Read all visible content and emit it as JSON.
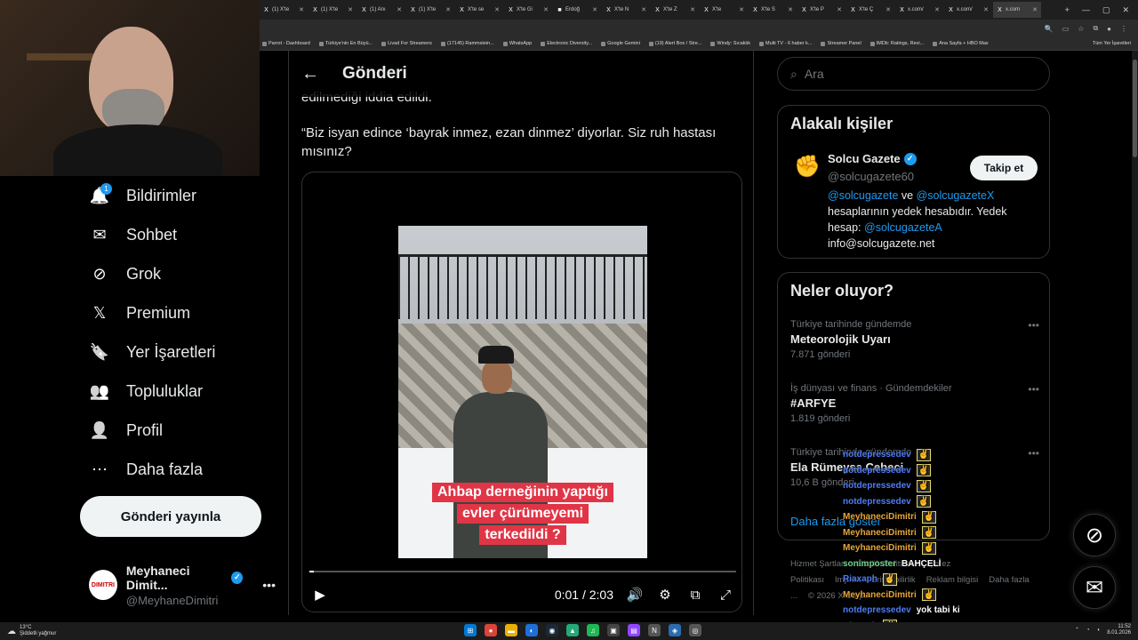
{
  "browser": {
    "tabs": [
      {
        "icon": "X",
        "label": "(1) X'te"
      },
      {
        "icon": "X",
        "label": "(1) X'te"
      },
      {
        "icon": "X",
        "label": "(1) Anı"
      },
      {
        "icon": "X",
        "label": "(1) X'te"
      },
      {
        "icon": "X",
        "label": "X'te se"
      },
      {
        "icon": "X",
        "label": "X'te Gi"
      },
      {
        "icon": "■",
        "label": "Erdoğ"
      },
      {
        "icon": "X",
        "label": "X'te N"
      },
      {
        "icon": "X",
        "label": "X'te Z"
      },
      {
        "icon": "X",
        "label": "X'te"
      },
      {
        "icon": "X",
        "label": "X'te S"
      },
      {
        "icon": "X",
        "label": "X'te P"
      },
      {
        "icon": "X",
        "label": "X'te Ç"
      },
      {
        "icon": "X",
        "label": "x.com/"
      },
      {
        "icon": "X",
        "label": "x.com/"
      },
      {
        "icon": "X",
        "label": "x.com"
      }
    ],
    "bookmarks": [
      "Parrot - Dashboard",
      "Türkiye'nin En Büyü...",
      "Livad For Streamers",
      "(17145) Rammstein...",
      "WhatsApp",
      "Electronic Diversity...",
      "Google Gemini",
      "(19) Alert Box / Stre...",
      "Windy: Sıcaklık",
      "Multi TV - 6 haber k...",
      "Streamer Panel",
      "IMDb: Ratings, Revi...",
      "Ana Sayfa + HBO Max"
    ],
    "all_bookmarks": "Tüm Yer İşaretleri"
  },
  "nav": {
    "notifications_badge": "1",
    "items": [
      {
        "label": "Bildirimler",
        "icon": "bell-icon"
      },
      {
        "label": "Sohbet",
        "icon": "mail-icon"
      },
      {
        "label": "Grok",
        "icon": "grok-icon"
      },
      {
        "label": "Premium",
        "icon": "x-logo-icon"
      },
      {
        "label": "Yer İşaretleri",
        "icon": "bookmark-icon"
      },
      {
        "label": "Topluluklar",
        "icon": "communities-icon"
      },
      {
        "label": "Profil",
        "icon": "person-icon"
      },
      {
        "label": "Daha fazla",
        "icon": "more-circle-icon"
      }
    ],
    "post_button": "Gönderi yayınla",
    "profile": {
      "name": "Meyhaneci Dimit...",
      "handle": "@MeyhaneDimitri",
      "avatar_text": "DIMITRI"
    }
  },
  "post": {
    "header_title": "Gönderi",
    "text_cut": "edilmediği iddia edildi.",
    "text_quote": "“Biz isyan edince ‘bayrak inmez, ezan dinmez’ diyorlar. Siz ruh hastası mısınız?",
    "video": {
      "caption_lines": [
        "Ahbap derneğinin yaptığı",
        "evler çürümeyemi",
        "terkedildi ?"
      ],
      "time": "0:01 / 2:03",
      "progress": 0.008
    }
  },
  "sidebar": {
    "search_placeholder": "Ara",
    "related_title": "Alakalı kişiler",
    "related": {
      "name": "Solcu Gazete",
      "handle": "@solcugazete60",
      "follow_label": "Takip et",
      "bio_link1": "@solcugazete",
      "bio_and": " ve ",
      "bio_link2": "@solcugazeteX",
      "bio_text": " hesaplarının yedek hesabıdır. Yedek hesap: ",
      "bio_link3": "@solcugazeteA",
      "bio_email": "info@solcugazete.net"
    },
    "trends_title": "Neler oluyor?",
    "trends": [
      {
        "meta": "Türkiye tarihinde gündemde",
        "name": "Meteorolojik Uyarı",
        "count": "7.871 gönderi"
      },
      {
        "meta": "İş dünyası ve finans · Gündemdekiler",
        "name": "#ARFYE",
        "count": "1.819 gönderi"
      },
      {
        "meta": "Türkiye tarihinde gündemde",
        "name": "Ela Rümeysa Cebeci",
        "count": "10,6 B gönderi"
      }
    ],
    "show_more": "Daha fazla göster",
    "footer": [
      "Hizmet Şartları",
      "Gizlilik Politikası",
      "Çerez Politikası",
      "Imprint",
      "Erişilebilirlik",
      "Reklam bilgisi",
      "Daha fazla ...",
      "© 2026 X Corp."
    ]
  },
  "chat": [
    {
      "user": "notdepressedev",
      "color": "#4f7cf5",
      "msg": "",
      "emote": true
    },
    {
      "user": "notdepressedev",
      "color": "#4f7cf5",
      "msg": "",
      "emote": true
    },
    {
      "user": "notdepressedev",
      "color": "#4f7cf5",
      "msg": "",
      "emote": true
    },
    {
      "user": "notdepressedev",
      "color": "#4f7cf5",
      "msg": "",
      "emote": true
    },
    {
      "user": "MeyhaneciDimitri",
      "color": "#e6a53a",
      "msg": "",
      "emote": true
    },
    {
      "user": "MeyhaneciDimitri",
      "color": "#e6a53a",
      "msg": "",
      "emote": true
    },
    {
      "user": "MeyhaneciDimitri",
      "color": "#e6a53a",
      "msg": "",
      "emote": true
    },
    {
      "user": "sonimposter",
      "color": "#6fd38f",
      "msg": "BAHÇELİ",
      "emote": false
    },
    {
      "user": "Riaxaph",
      "color": "#4f7cf5",
      "msg": "",
      "emote": true
    },
    {
      "user": "MeyhaneciDimitri",
      "color": "#e6a53a",
      "msg": "",
      "emote": true
    },
    {
      "user": "notdepressedev",
      "color": "#4f7cf5",
      "msg": "yok tabi ki",
      "emote": false
    },
    {
      "user": "Riaxaph",
      "color": "#4f7cf5",
      "msg": "",
      "emote": true
    }
  ],
  "taskbar": {
    "temp": "13°C",
    "weather": "Şiddetli yağmur",
    "time": "11:52",
    "date": "8.01.2026"
  }
}
